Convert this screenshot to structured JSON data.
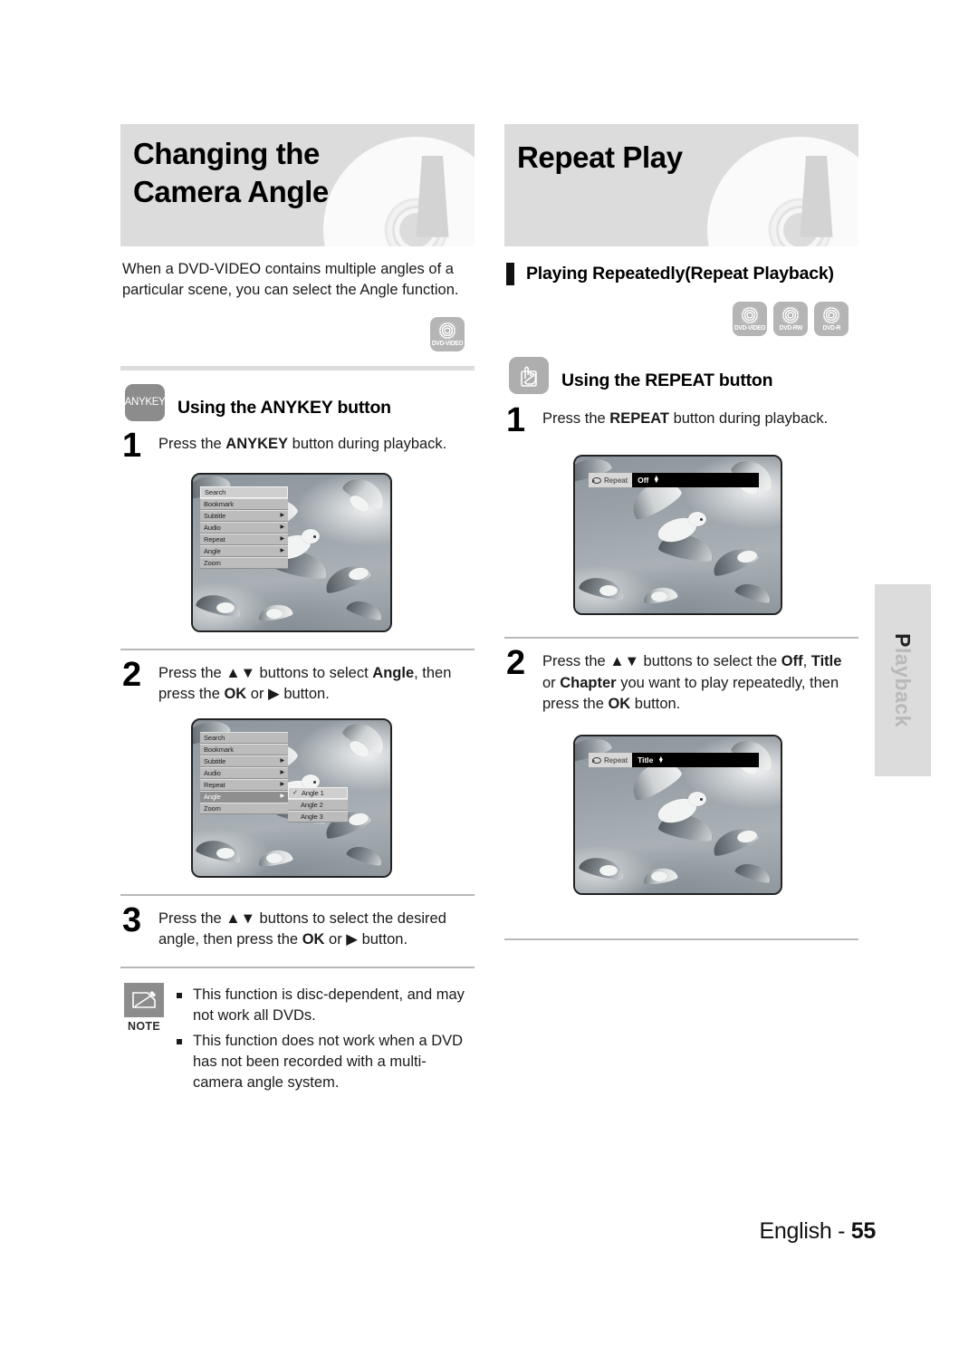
{
  "page": {
    "footer_language": "English",
    "footer_separator": " - ",
    "footer_number": "55",
    "side_tab": "Playback",
    "side_tab_first": "P",
    "side_tab_rest": "layback"
  },
  "left_column": {
    "banner_title": "Changing the Camera Angle",
    "intro": "When a DVD-VIDEO contains multiple angles of a particular scene, you can select the Angle function.",
    "disc_badge": {
      "icon": "dvd-disc-icon",
      "label": "DVD-VIDEO"
    },
    "sub_head": {
      "key_icon_label": "ANYKEY",
      "title": "Using the ANYKEY button"
    },
    "steps": [
      {
        "number": "1",
        "text_parts": [
          {
            "text": "Press the ",
            "bold": false
          },
          {
            "text": "ANYKEY",
            "bold": true
          },
          {
            "text": " button during playback.",
            "bold": false
          }
        ],
        "text_plain": "Press the ANYKEY button during playback."
      },
      {
        "number": "2",
        "text_plain": "Press the ▲▼ buttons to select Angle, then press the OK or ▶ button."
      },
      {
        "number": "3",
        "text_plain": "Press the ▲▼ buttons to select the desired angle, then press the OK or ▶ button."
      }
    ],
    "figure1": {
      "caption": "anykey-menu-screenshot",
      "menu_items": [
        {
          "label": "Search",
          "state": "selected",
          "arrow": ""
        },
        {
          "label": "Bookmark",
          "state": "normal",
          "arrow": ""
        },
        {
          "label": "Subtitle",
          "state": "normal",
          "arrow": "▶"
        },
        {
          "label": "Audio",
          "state": "normal",
          "arrow": "▶"
        },
        {
          "label": "Repeat",
          "state": "normal",
          "arrow": "▶"
        },
        {
          "label": "Angle",
          "state": "normal",
          "arrow": "▶"
        },
        {
          "label": "Zoom",
          "state": "normal",
          "arrow": ""
        }
      ]
    },
    "figure2": {
      "caption": "anykey-angle-submenu-screenshot",
      "menu_items": [
        {
          "label": "Search",
          "state": "normal",
          "arrow": ""
        },
        {
          "label": "Bookmark",
          "state": "normal",
          "arrow": ""
        },
        {
          "label": "Subtitle",
          "state": "normal",
          "arrow": "▶"
        },
        {
          "label": "Audio",
          "state": "normal",
          "arrow": "▶"
        },
        {
          "label": "Repeat",
          "state": "normal",
          "arrow": "▶"
        },
        {
          "label": "Angle",
          "state": "active",
          "arrow": "▶"
        },
        {
          "label": "Zoom",
          "state": "normal",
          "arrow": ""
        }
      ],
      "submenu_items": [
        {
          "label": "Angle 1",
          "state": "selected",
          "check": "✓"
        },
        {
          "label": "Angle 2",
          "state": "normal",
          "check": ""
        },
        {
          "label": "Angle 3",
          "state": "normal",
          "check": ""
        }
      ]
    },
    "note": {
      "icon": "pencil-note-icon",
      "label": "NOTE",
      "items": [
        "This function is disc-dependent, and may not work all DVDs.",
        "This function does not work when a DVD has not been recorded with a multi-camera angle system."
      ]
    }
  },
  "right_column": {
    "banner_title": "Repeat Play",
    "section_head": "Playing Repeatedly(Repeat Playback)",
    "disc_badges": [
      {
        "icon": "dvd-disc-icon",
        "label": "DVD-VIDEO"
      },
      {
        "icon": "dvd-disc-icon",
        "label": "DVD-RW"
      },
      {
        "icon": "dvd-disc-icon",
        "label": "DVD-R"
      }
    ],
    "sub_head": {
      "key_icon": "hand-press-button-icon",
      "title": "Using the REPEAT button"
    },
    "steps": [
      {
        "number": "1",
        "text_plain": "Press the REPEAT button during playback."
      },
      {
        "number": "2",
        "text_plain": "Press the ▲▼ buttons to select the Off, Title or Chapter you want to play repeatedly, then press the OK button."
      }
    ],
    "figure1": {
      "caption": "repeat-osd-off-screenshot",
      "osd": {
        "icon": "repeat-loop-icon",
        "label": "Repeat",
        "value": "Off",
        "arrows": "▲▼"
      }
    },
    "figure2": {
      "caption": "repeat-osd-title-screenshot",
      "osd": {
        "icon": "repeat-loop-icon",
        "label": "Repeat",
        "value": "Title",
        "arrows": "▲▼"
      }
    }
  },
  "colors": {
    "banner_bg": "#dcdcdc",
    "badge_gray": "#b5b5b5",
    "key_icon_gray": "#8c8c8c",
    "osd_black": "#000000",
    "text": "#1a1a1a"
  }
}
